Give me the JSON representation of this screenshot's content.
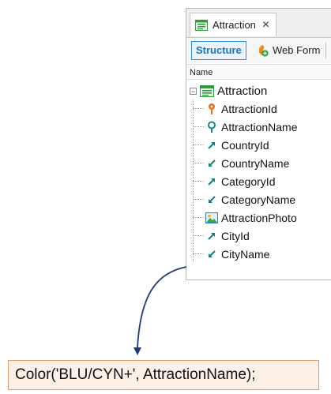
{
  "tab": {
    "title": "Attraction",
    "close": "×"
  },
  "toolbar": {
    "structure_label": "Structure",
    "webform_label": "Web Form"
  },
  "columns": {
    "name_header": "Name"
  },
  "tree": {
    "root_label": "Attraction",
    "expander": "−",
    "attributes": [
      {
        "label": "AttractionId",
        "icon": "key-icon"
      },
      {
        "label": "AttractionName",
        "icon": "search-key-icon"
      },
      {
        "label": "CountryId",
        "icon": "foreign-key-out-icon"
      },
      {
        "label": "CountryName",
        "icon": "inferred-attribute-icon"
      },
      {
        "label": "CategoryId",
        "icon": "foreign-key-out-icon"
      },
      {
        "label": "CategoryName",
        "icon": "inferred-attribute-icon"
      },
      {
        "label": "AttractionPhoto",
        "icon": "image-icon"
      },
      {
        "label": "CityId",
        "icon": "foreign-key-out-icon"
      },
      {
        "label": "CityName",
        "icon": "inferred-attribute-icon"
      }
    ]
  },
  "code": {
    "text": "Color('BLU/CYN+', AttractionName);"
  },
  "colors": {
    "accent": "#1e76c0",
    "code_bg": "#fdf0e7",
    "code_border": "#e39a6a",
    "arrow": "#1f3a78",
    "teal": "#0f8a8a"
  }
}
